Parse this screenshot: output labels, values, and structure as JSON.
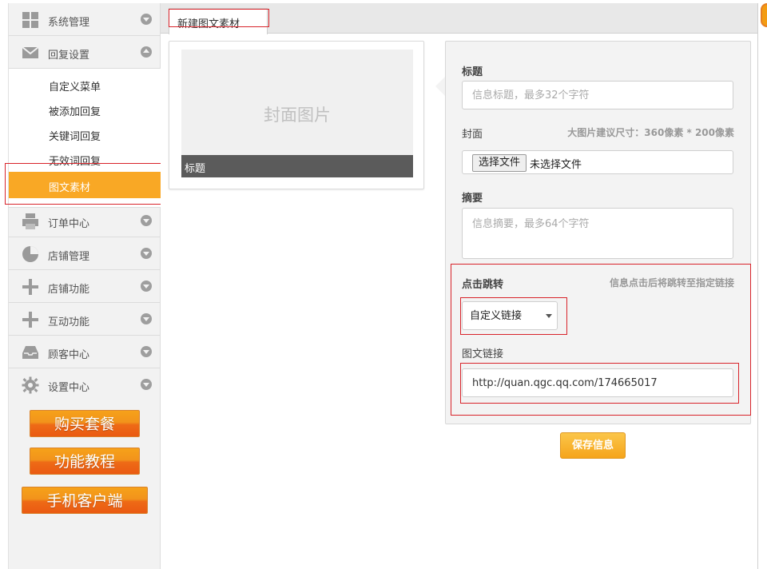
{
  "sidebar": {
    "items": [
      {
        "label": "系统管理",
        "icon": "grid-icon"
      },
      {
        "label": "回复设置",
        "icon": "envelope-icon"
      },
      {
        "label": "订单中心",
        "icon": "printer-icon"
      },
      {
        "label": "店铺管理",
        "icon": "pie-chart-icon"
      },
      {
        "label": "店铺功能",
        "icon": "plus-icon"
      },
      {
        "label": "互动功能",
        "icon": "plus-icon"
      },
      {
        "label": "顾客中心",
        "icon": "inbox-icon"
      },
      {
        "label": "设置中心",
        "icon": "gear-icon"
      }
    ],
    "submenu": [
      "自定义菜单",
      "被添加回复",
      "关键词回复",
      "无效词回复",
      "图文素材"
    ],
    "active_sub": "图文素材",
    "promos": [
      "购买套餐",
      "功能教程",
      "手机客户端"
    ]
  },
  "tab": {
    "label": "新建图文素材"
  },
  "preview": {
    "cover_placeholder": "封面图片",
    "title": "标题"
  },
  "form": {
    "title_label": "标题",
    "title_placeholder": "信息标题，最多32个字符",
    "cover_label": "封面",
    "cover_hint": "大图片建议尺寸：360像素 * 200像素",
    "file_button": "选择文件",
    "file_status": "未选择文件",
    "summary_label": "摘要",
    "summary_placeholder": "信息摘要，最多64个字符",
    "jump_label": "点击跳转",
    "jump_hint": "信息点击后将跳转至指定链接",
    "jump_select": "自定义链接",
    "link_label": "图文链接",
    "link_value": "http://quan.qgc.qq.com/174665017",
    "save_button": "保存信息"
  },
  "colors": {
    "accent": "#f9a825",
    "highlight": "#d8232a",
    "promo": "#ee6a16"
  }
}
